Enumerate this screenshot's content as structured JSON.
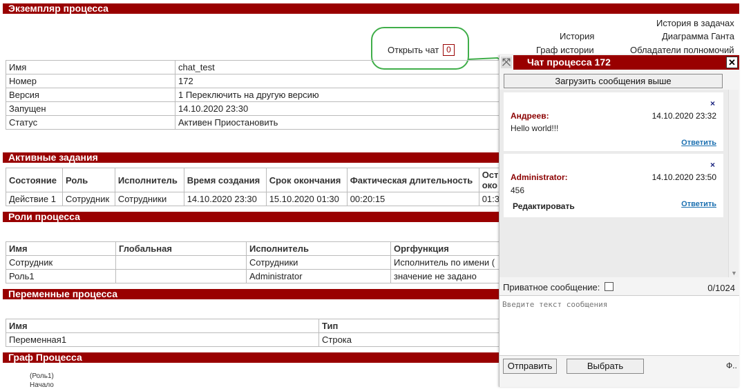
{
  "header": {
    "title": "Экземпляр процесса"
  },
  "links": {
    "task_history": "История в задачах",
    "history": "История",
    "gantt": "Диаграмма Ганта",
    "history_graph": "Граф истории",
    "owners": "Обладатели полномочий",
    "open_chat": "Открыть чат",
    "chat_count": "0"
  },
  "info": {
    "rows": [
      {
        "label": "Имя",
        "value": "chat_test"
      },
      {
        "label": "Номер",
        "value": "172"
      },
      {
        "label": "Версия",
        "value": "1 Переключить на другую версию"
      },
      {
        "label": "Запущен",
        "value": "14.10.2020 23:30"
      },
      {
        "label": "Статус",
        "value": "Активен Приостановить"
      }
    ]
  },
  "tasks": {
    "title": "Активные задания",
    "headers": [
      "Состояние",
      "Роль",
      "Исполнитель",
      "Время создания",
      "Срок окончания",
      "Фактическая длительность",
      "Ост око"
    ],
    "row": [
      "Действие 1",
      "Сотрудник",
      "Сотрудники",
      "14.10.2020 23:30",
      "15.10.2020 01:30",
      "00:20:15",
      "01:3"
    ]
  },
  "roles": {
    "title": "Роли процесса",
    "headers": [
      "Имя",
      "Глобальная",
      "Исполнитель",
      "Оргфункция"
    ],
    "rows": [
      [
        "Сотрудник",
        "",
        "Сотрудники",
        "Исполнитель по имени ("
      ],
      [
        "Роль1",
        "",
        "Administrator",
        "значение не задано"
      ]
    ]
  },
  "variables": {
    "title": "Переменные процесса",
    "headers": [
      "Имя",
      "Тип"
    ],
    "rows": [
      [
        "Переменная1",
        "Строка"
      ]
    ]
  },
  "graph": {
    "title": "Граф Процесса",
    "label1": "(Роль1)",
    "label2": "Начало"
  },
  "chat": {
    "title": "Чат процесса 172",
    "load_more": "Загрузить сообщения выше",
    "messages": [
      {
        "author": "Андреев:",
        "time": "14.10.2020 23:32",
        "text": "Hello world!!!",
        "reply": "Ответить",
        "edit": ""
      },
      {
        "author": "Administrator:",
        "time": "14.10.2020 23:50",
        "text": "456",
        "reply": "Ответить",
        "edit": "Редактировать"
      }
    ],
    "private_label": "Приватное сообщение:",
    "counter": "0/1024",
    "placeholder": "Введите текст сообщения",
    "send": "Отправить",
    "choose": "Выбрать",
    "trailing": "Ф.."
  }
}
